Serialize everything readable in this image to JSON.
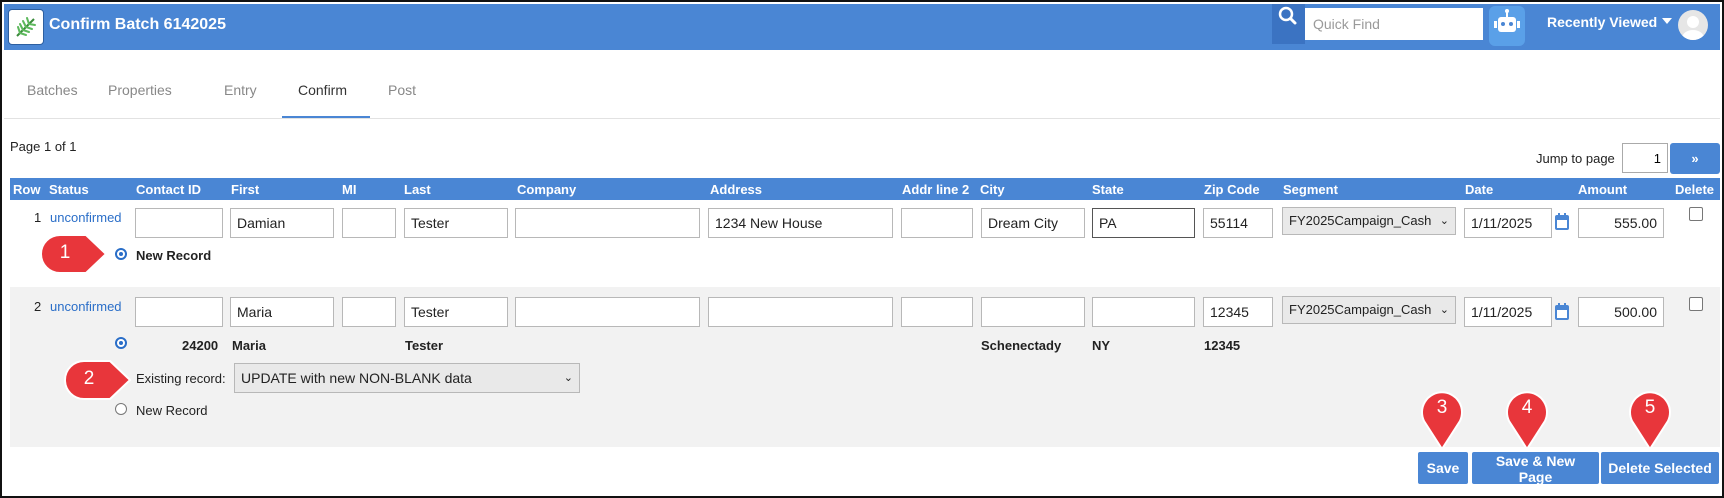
{
  "app": {
    "title": "Confirm Batch 6142025"
  },
  "search": {
    "placeholder": "Quick Find"
  },
  "header": {
    "recently_viewed": "Recently Viewed"
  },
  "tabs": [
    "Batches",
    "Properties",
    "Entry",
    "Confirm",
    "Post"
  ],
  "active_tab": "Confirm",
  "pagination": {
    "info": "Page 1 of 1",
    "jump_label": "Jump to page",
    "jump_value": "1",
    "go_label": "»"
  },
  "columns": [
    "Row",
    "Status",
    "Contact ID",
    "First",
    "MI",
    "Last",
    "Company",
    "Address",
    "Addr line 2",
    "City",
    "State",
    "Zip Code",
    "Segment",
    "Date",
    "Amount",
    "Delete"
  ],
  "rows": [
    {
      "row": "1",
      "status": "unconfirmed",
      "contact_id": "",
      "first": "Damian",
      "mi": "",
      "last": "Tester",
      "company": "",
      "address": "1234 New House",
      "addr2": "",
      "city": "Dream City",
      "state": "PA",
      "zip": "55114",
      "segment": "FY2025Campaign_Cash",
      "date": "1/11/2025",
      "amount": "555.00",
      "new_record_label": "New Record"
    },
    {
      "row": "2",
      "status": "unconfirmed",
      "contact_id": "",
      "first": "Maria",
      "mi": "",
      "last": "Tester",
      "company": "",
      "address": "",
      "addr2": "",
      "city": "",
      "state": "",
      "zip": "12345",
      "segment": "FY2025Campaign_Cash",
      "date": "1/11/2025",
      "amount": "500.00",
      "match": {
        "contact_id": "24200",
        "first": "Maria",
        "last": "Tester",
        "city": "Schenectady",
        "state": "NY",
        "zip": "12345"
      },
      "existing_label": "Existing record:",
      "existing_option": "UPDATE with new NON-BLANK data",
      "new_record_label": "New Record"
    }
  ],
  "buttons": {
    "save": "Save",
    "save_new_page": "Save & New Page",
    "delete_selected": "Delete Selected"
  },
  "markers": [
    "1",
    "2",
    "3",
    "4",
    "5"
  ],
  "colors": {
    "header": "#4a86d4",
    "marker": "#e8363b",
    "link": "#2a6ec8"
  }
}
